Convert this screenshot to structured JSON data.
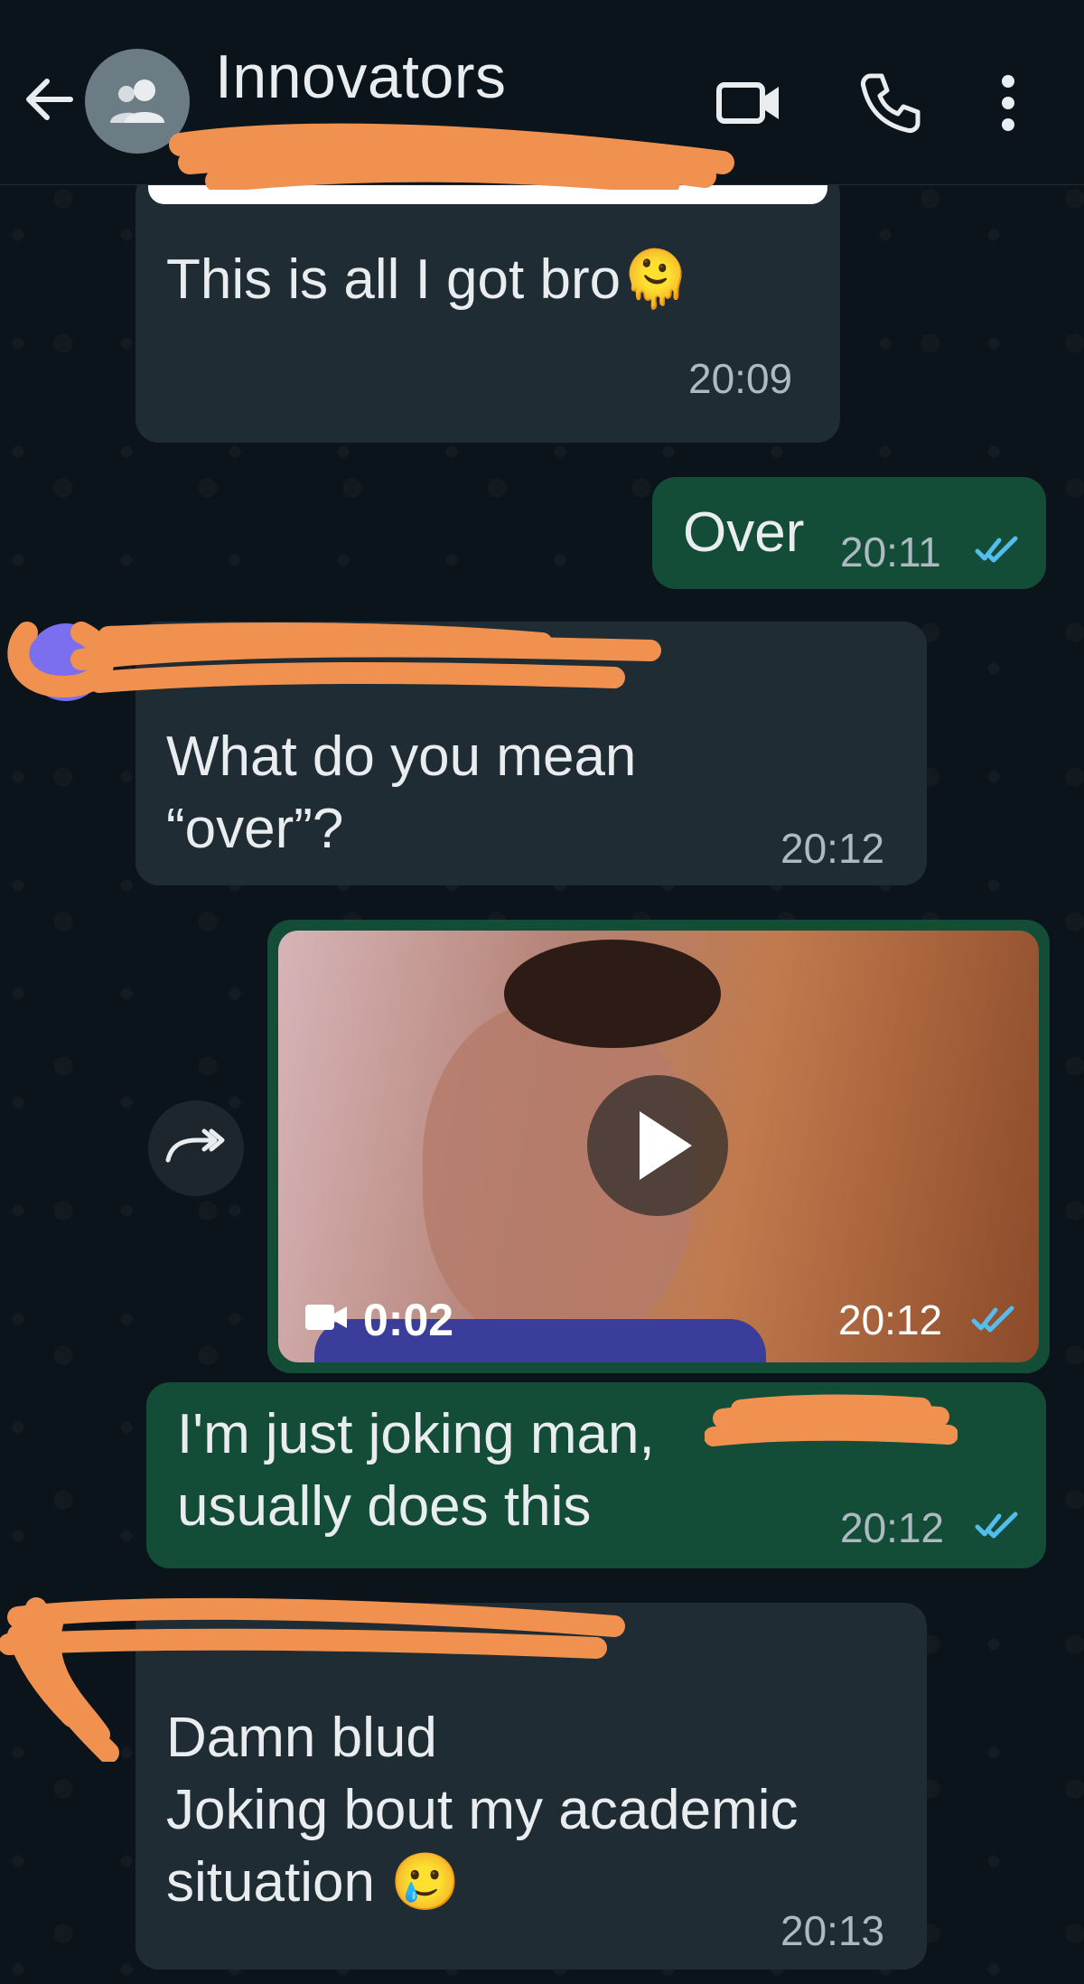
{
  "header": {
    "title": "Innovators"
  },
  "messages": [
    {
      "kind": "incoming",
      "text": "This is all I got bro🫠",
      "time": "20:09"
    },
    {
      "kind": "outgoing",
      "text": "Over",
      "time": "20:11"
    },
    {
      "kind": "incoming",
      "text": "What do you mean\n“over”?",
      "time": "20:12"
    },
    {
      "kind": "outgoing-video",
      "duration": "0:02",
      "time": "20:12"
    },
    {
      "kind": "outgoing",
      "text": "I'm just joking man,\nusually does this",
      "time": "20:12"
    },
    {
      "kind": "incoming",
      "text": "Damn blud\nJoking bout my academic\nsituation 🥲",
      "time": "20:13"
    }
  ],
  "colors": {
    "background": "#0b141a",
    "incoming_bubble": "#202c33",
    "outgoing_bubble": "#134d37",
    "read_tick": "#53bdeb",
    "redaction": "#f0914f"
  },
  "icons": [
    "back-arrow-icon",
    "group-avatar-icon",
    "video-call-icon",
    "phone-icon",
    "more-options-icon",
    "read-ticks-icon",
    "play-icon",
    "video-camera-icon",
    "forward-icon"
  ]
}
